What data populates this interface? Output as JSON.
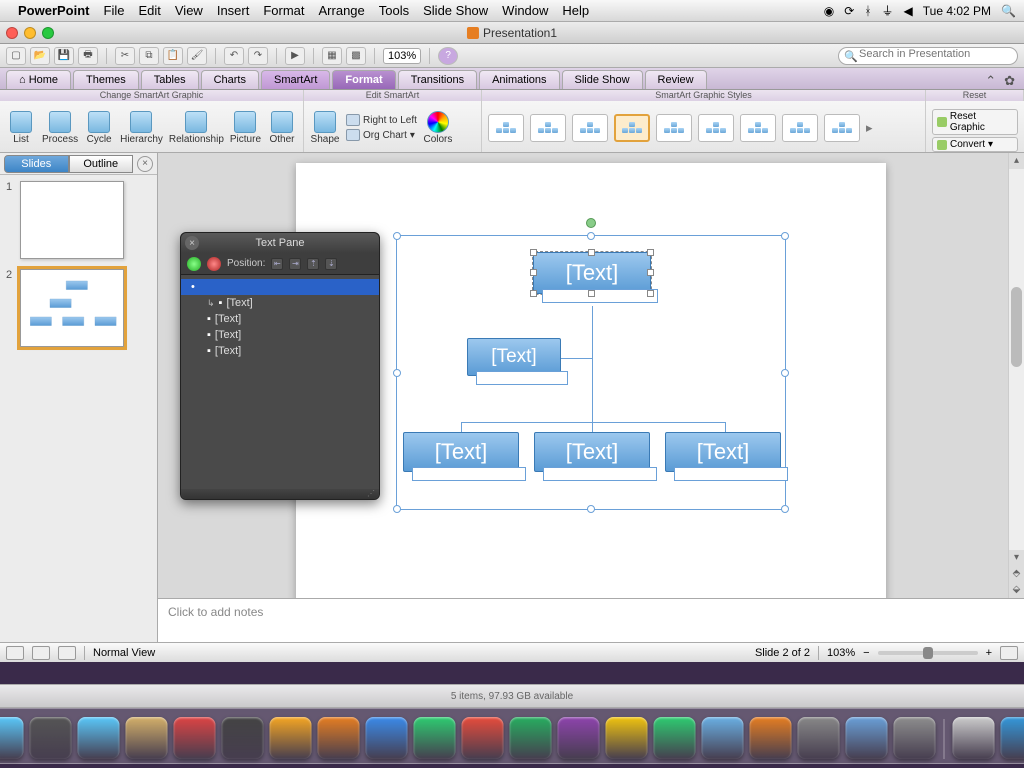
{
  "menubar": {
    "app": "PowerPoint",
    "items": [
      "File",
      "Edit",
      "View",
      "Insert",
      "Format",
      "Arrange",
      "Tools",
      "Slide Show",
      "Window",
      "Help"
    ],
    "clock": "Tue 4:02 PM"
  },
  "window": {
    "title": "Presentation1",
    "search_placeholder": "Search in Presentation",
    "zoom": "103%"
  },
  "ribbon": {
    "tabs": [
      "Home",
      "Themes",
      "Tables",
      "Charts",
      "SmartArt",
      "Format",
      "Transitions",
      "Animations",
      "Slide Show",
      "Review"
    ],
    "active_tab": "Format",
    "highlight_tab": "SmartArt",
    "groups": {
      "change": {
        "label": "Change SmartArt Graphic",
        "items": [
          "List",
          "Process",
          "Cycle",
          "Hierarchy",
          "Relationship",
          "Picture",
          "Other"
        ]
      },
      "edit": {
        "label": "Edit SmartArt",
        "shape": "Shape",
        "rtl": "Right to Left",
        "org": "Org Chart",
        "colors": "Colors"
      },
      "styles": {
        "label": "SmartArt Graphic Styles"
      },
      "reset": {
        "label": "Reset",
        "reset": "Reset Graphic",
        "convert": "Convert"
      }
    }
  },
  "slidepanel": {
    "tabs": [
      "Slides",
      "Outline"
    ],
    "active": "Slides",
    "slides": [
      1,
      2
    ],
    "selected": 2
  },
  "textpane": {
    "title": "Text Pane",
    "position_label": "Position:",
    "items": [
      "",
      "[Text]",
      "[Text]",
      "[Text]",
      "[Text]"
    ]
  },
  "smartart": {
    "placeholder": "[Text]"
  },
  "notes": {
    "placeholder": "Click to add notes"
  },
  "status": {
    "view_label": "Normal View",
    "slide_info": "Slide 2 of 2",
    "zoom": "103%"
  },
  "dock": {
    "strip": "5 items, 97.93 GB available",
    "apps": [
      "finder",
      "dashboard",
      "safari",
      "mail",
      "ical",
      "preview",
      "photobooth",
      "firefox",
      "word",
      "powerpoint",
      "excel",
      "onenote",
      "outlook",
      "messenger",
      "communicator",
      "rdc",
      "sync",
      "silverlight",
      "query",
      "automator",
      "appstore",
      "trash"
    ],
    "colors": [
      "#5ac8fa",
      "#555",
      "#5ac8fa",
      "#d4b06a",
      "#d44",
      "#444",
      "#f5a623",
      "#e67e22",
      "#3b8bea",
      "#2ecc71",
      "#e74c3c",
      "#27ae60",
      "#8e44ad",
      "#f1c40f",
      "#2ecc71",
      "#6ab0e4",
      "#e67e22",
      "#888",
      "#6aa0d8",
      "#8e8e8e",
      "#ccc",
      "#3498db",
      "#888"
    ]
  }
}
